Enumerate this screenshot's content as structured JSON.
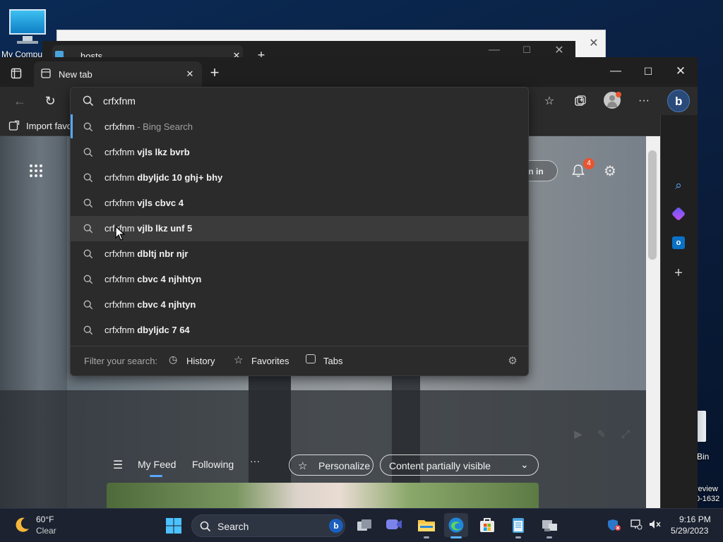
{
  "desktop": {
    "my_computer_label": "My Compu",
    "recycle_bin_label": "Bin",
    "preview_line1": "review",
    "preview_line2": "0-1632"
  },
  "background_windows": {
    "notepad_tab_title": "hosts"
  },
  "browser": {
    "tab_title": "New tab",
    "address_value": "crfxfnm",
    "favorites_bar_item": "Import favo",
    "sign_in_label": "gn in",
    "notification_count": "4"
  },
  "suggestions": {
    "items": [
      {
        "prefix": "crfxfnm",
        "bold": "",
        "suffix": " - Bing Search",
        "highlight": false
      },
      {
        "prefix": "crfxfnm ",
        "bold": "vjls lkz bvrb",
        "suffix": "",
        "highlight": false
      },
      {
        "prefix": "crfxfnm ",
        "bold": "dbyljdc 10 ghj+ bhy",
        "suffix": "",
        "highlight": false
      },
      {
        "prefix": "crfxfnm ",
        "bold": "vjls cbvc 4",
        "suffix": "",
        "highlight": false
      },
      {
        "prefix": "crfxfnm ",
        "bold": "vjlb lkz unf 5",
        "suffix": "",
        "highlight": true
      },
      {
        "prefix": "crfxfnm ",
        "bold": "dbltj nbr njr",
        "suffix": "",
        "highlight": false
      },
      {
        "prefix": "crfxfnm ",
        "bold": "cbvc 4 njhhtyn",
        "suffix": "",
        "highlight": false
      },
      {
        "prefix": "crfxfnm ",
        "bold": "cbvc 4 njhtyn",
        "suffix": "",
        "highlight": false
      },
      {
        "prefix": "crfxfnm ",
        "bold": "dbyljdc 7 64",
        "suffix": "",
        "highlight": false
      }
    ],
    "filter_label": "Filter your search:",
    "filter_history": "History",
    "filter_favorites": "Favorites",
    "filter_tabs": "Tabs"
  },
  "feed": {
    "my_feed": "My Feed",
    "following": "Following",
    "more": "···",
    "personalize": "Personalize",
    "content_visibility": "Content partially visible"
  },
  "taskbar": {
    "weather_temp": "60°F",
    "weather_condition": "Clear",
    "search_placeholder": "Search",
    "time": "9:16 PM",
    "date": "5/29/2023"
  },
  "colors": {
    "accent": "#58a6ff",
    "badge": "#e8552f",
    "taskbar": "#1c2230"
  }
}
